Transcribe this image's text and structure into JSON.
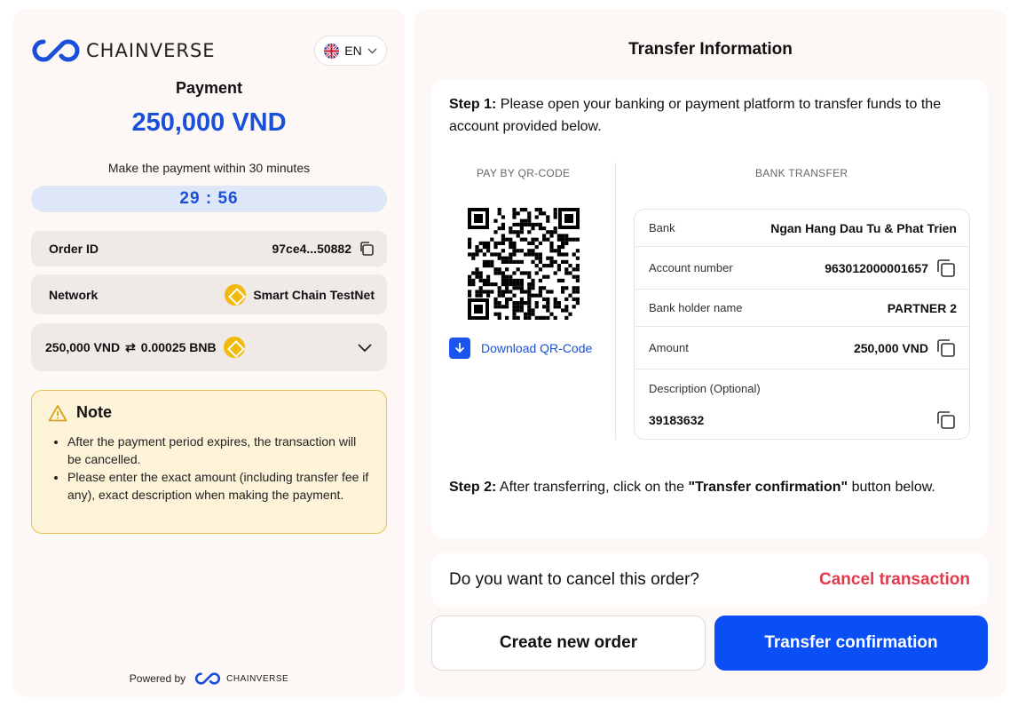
{
  "brand": {
    "name": "CHAINVERSE",
    "accent": "#1a4fd8"
  },
  "language": {
    "code": "EN"
  },
  "payment": {
    "title": "Payment",
    "amount": "250,000 VND",
    "within": "Make the payment within 30 minutes",
    "countdown": "29 : 56"
  },
  "order": {
    "label": "Order ID",
    "value": "97ce4...50882"
  },
  "network": {
    "label": "Network",
    "value": "Smart Chain TestNet"
  },
  "conversion": {
    "from": "250,000 VND",
    "to": "0.00025 BNB"
  },
  "note": {
    "title": "Note",
    "items": [
      "After the payment period expires, the transaction will be cancelled.",
      "Please enter the exact amount (including transfer fee if any), exact description when making the payment."
    ]
  },
  "footer": {
    "powered_by": "Powered by",
    "brand": "CHAINVERSE"
  },
  "transfer": {
    "title": "Transfer Information",
    "step1_label": "Step 1:",
    "step1_text": "Please open your banking or payment platform to transfer funds to the account provided below.",
    "qr_heading": "PAY BY QR-CODE",
    "bank_heading": "BANK TRANSFER",
    "download_label": "Download QR-Code",
    "bank": {
      "bank_label": "Bank",
      "bank_value": "Ngan Hang Dau Tu & Phat Trien",
      "account_label": "Account number",
      "account_value": "963012000001657",
      "holder_label": "Bank holder name",
      "holder_value": "PARTNER 2",
      "amount_label": "Amount",
      "amount_value": "250,000 VND",
      "desc_label": "Description (Optional)",
      "desc_value": "39183632"
    },
    "step2_label": "Step 2:",
    "step2_pre": "After transferring, click on the",
    "step2_bold": "\"Transfer confirmation\"",
    "step2_post": "button below."
  },
  "cancel": {
    "question": "Do you want to cancel this order?",
    "link": "Cancel transaction"
  },
  "buttons": {
    "create": "Create new order",
    "confirm": "Transfer confirmation"
  }
}
